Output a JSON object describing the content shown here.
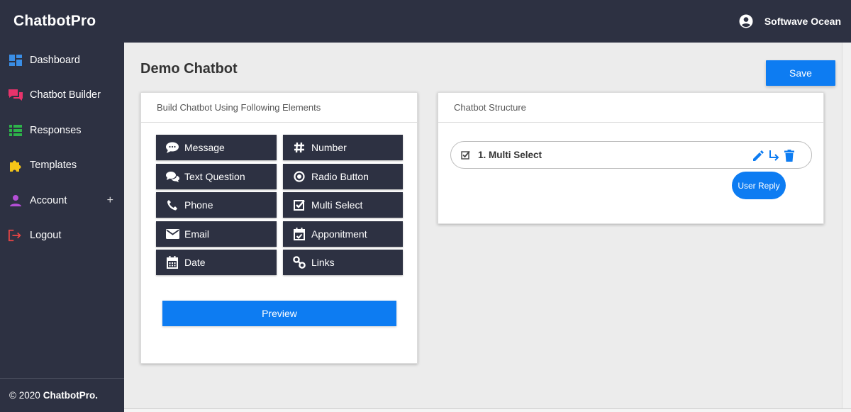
{
  "app": {
    "brand": "ChatbotPro",
    "user_name": "Softwave Ocean"
  },
  "sidebar": {
    "items": [
      {
        "label": "Dashboard",
        "icon": "dashboard-icon",
        "color": "#3a8ee6"
      },
      {
        "label": "Chatbot Builder",
        "icon": "chat-icon",
        "color": "#e8336b"
      },
      {
        "label": "Responses",
        "icon": "list-icon",
        "color": "#2db34a"
      },
      {
        "label": "Templates",
        "icon": "puzzle-icon",
        "color": "#f5c518"
      },
      {
        "label": "Account",
        "icon": "person-icon",
        "color": "#b44fd6",
        "expand": "+"
      },
      {
        "label": "Logout",
        "icon": "logout-icon",
        "color": "#e84545"
      }
    ],
    "footer_prefix": "© 2020",
    "footer_brand": "ChatbotPro."
  },
  "page": {
    "title": "Demo Chatbot",
    "save_label": "Save"
  },
  "build_panel": {
    "title": "Build Chatbot Using Following Elements",
    "elements": [
      {
        "label": "Message",
        "icon": "speech-bubble-icon"
      },
      {
        "label": "Number",
        "icon": "hash-icon"
      },
      {
        "label": "Text Question",
        "icon": "comments-icon"
      },
      {
        "label": "Radio Button",
        "icon": "radio-icon"
      },
      {
        "label": "Phone",
        "icon": "phone-icon"
      },
      {
        "label": "Multi Select",
        "icon": "checkbox-icon"
      },
      {
        "label": "Email",
        "icon": "envelope-icon"
      },
      {
        "label": "Apponitment",
        "icon": "calendar-check-icon"
      },
      {
        "label": "Date",
        "icon": "calendar-icon"
      },
      {
        "label": "Links",
        "icon": "link-icon"
      }
    ],
    "preview_label": "Preview"
  },
  "structure_panel": {
    "title": "Chatbot Structure",
    "item_label": "1. Multi Select",
    "user_reply_label": "User Reply"
  },
  "colors": {
    "dark": "#2d3142",
    "accent": "#0d7cf2",
    "background": "#ececec"
  }
}
